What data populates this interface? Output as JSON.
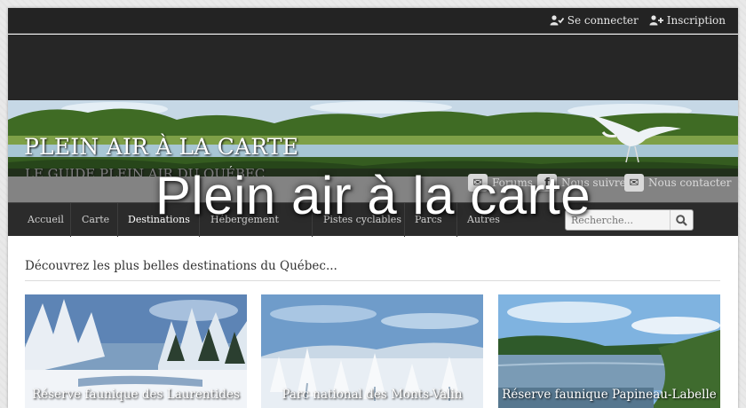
{
  "topbar": {
    "login_label": "Se connecter",
    "register_label": "Inscription"
  },
  "banner": {
    "site_title": "PLEIN AIR À LA CARTE",
    "tagline": "LE GUIDE PLEIN AIR DU QUÉBEC"
  },
  "social": {
    "forums_label": "Forums",
    "follow_label": "Nous suivre",
    "contact_label": "Nous contacter"
  },
  "nav": {
    "items": [
      "Accueil",
      "Carte",
      "Destinations",
      "Hébergement",
      "",
      "Pistes cyclables",
      "Parcs",
      "Autres"
    ],
    "active_index": 2
  },
  "search": {
    "placeholder": "Recherche...",
    "button_icon": "search-icon"
  },
  "overlay_title": "Plein air à la carte",
  "intro_text": "Découvrez les plus belles destinations du Québec...",
  "cards": [
    {
      "caption": "Réserve faunique des Laurentides"
    },
    {
      "caption": "Parc national des Monts-Valin"
    },
    {
      "caption": "Réserve faunique Papineau-Labelle"
    }
  ],
  "colors": {
    "topbar_bg": "#232323",
    "nav_bg": "#2b2b2b",
    "page_bg": "#e9e9e9"
  }
}
